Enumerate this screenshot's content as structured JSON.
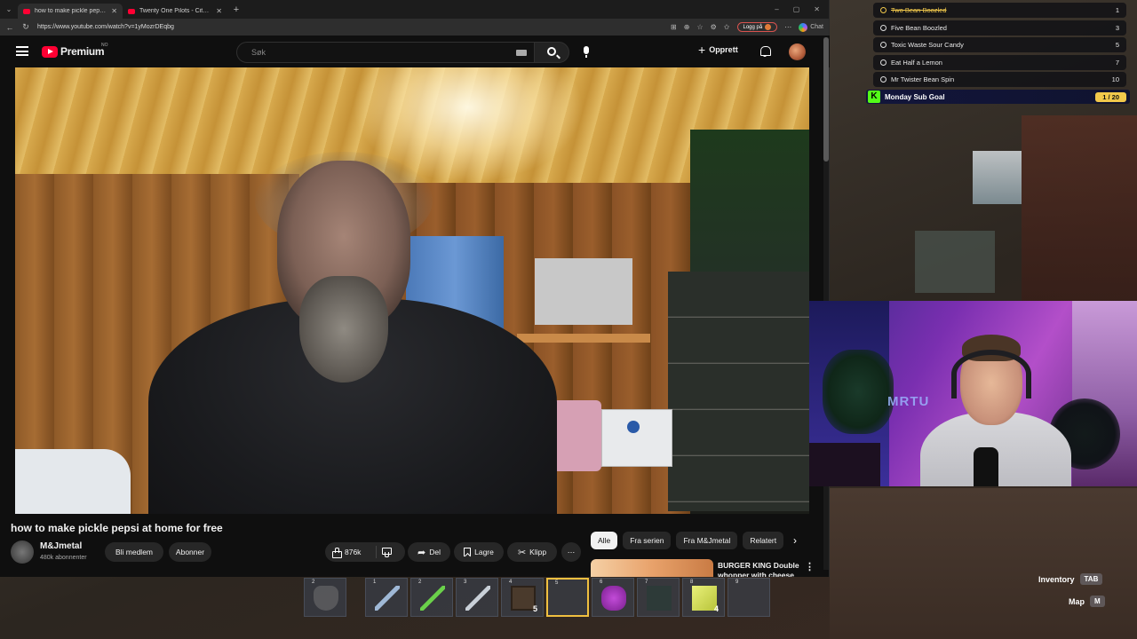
{
  "browser": {
    "tabs": [
      {
        "title": "how to make pickle pepsi at h",
        "active": true
      },
      {
        "title": "Twenty One Pilots - City Walls (Of",
        "active": false
      }
    ],
    "url": "https://www.youtube.com/watch?v=1yMozrDEqbg",
    "login_label": "Logg på",
    "chat_label": "Chat"
  },
  "youtube": {
    "logo_text": "Premium",
    "country": "NO",
    "search_placeholder": "Søk",
    "create_label": "Opprett",
    "video_title": "how to make pickle pepsi at home for free",
    "channel_name": "M&Jmetal",
    "channel_subs": "480k abonnenter",
    "join_label": "Bli medlem",
    "subscribe_label": "Abonner",
    "likes": "876k",
    "share_label": "Del",
    "save_label": "Lagre",
    "clip_label": "Klipp",
    "chips": [
      "Alle",
      "Fra serien",
      "Fra M&Jmetal",
      "Relatert"
    ],
    "rec_title": "BURGER KING Double whopper with cheese"
  },
  "goals": [
    {
      "label": "Two Bean Boozled",
      "value": "1",
      "done": true
    },
    {
      "label": "Five Bean Boozled",
      "value": "3",
      "done": false
    },
    {
      "label": "Toxic Waste Sour Candy",
      "value": "5",
      "done": false
    },
    {
      "label": "Eat Half a Lemon",
      "value": "7",
      "done": false
    },
    {
      "label": "Mr Twister Bean Spin",
      "value": "10",
      "done": false
    }
  ],
  "sub_goal": {
    "label": "Monday Sub Goal",
    "count": "1 / 20"
  },
  "webcam": {
    "sign_text": "MRTU"
  },
  "hotbar": [
    {
      "num": "2",
      "item": "shield",
      "count": ""
    },
    {
      "num": "1",
      "item": "sword",
      "count": ""
    },
    {
      "num": "2",
      "item": "pick-green",
      "count": ""
    },
    {
      "num": "3",
      "item": "pick-iron",
      "count": ""
    },
    {
      "num": "4",
      "item": "block",
      "count": "5"
    },
    {
      "num": "5",
      "item": "",
      "count": ""
    },
    {
      "num": "6",
      "item": "purple",
      "count": ""
    },
    {
      "num": "7",
      "item": "dark",
      "count": ""
    },
    {
      "num": "8",
      "item": "yellow",
      "count": "4"
    },
    {
      "num": "9",
      "item": "",
      "count": ""
    }
  ],
  "hints": {
    "inventory_label": "Inventory",
    "inventory_key": "TAB",
    "map_label": "Map",
    "map_key": "M"
  }
}
